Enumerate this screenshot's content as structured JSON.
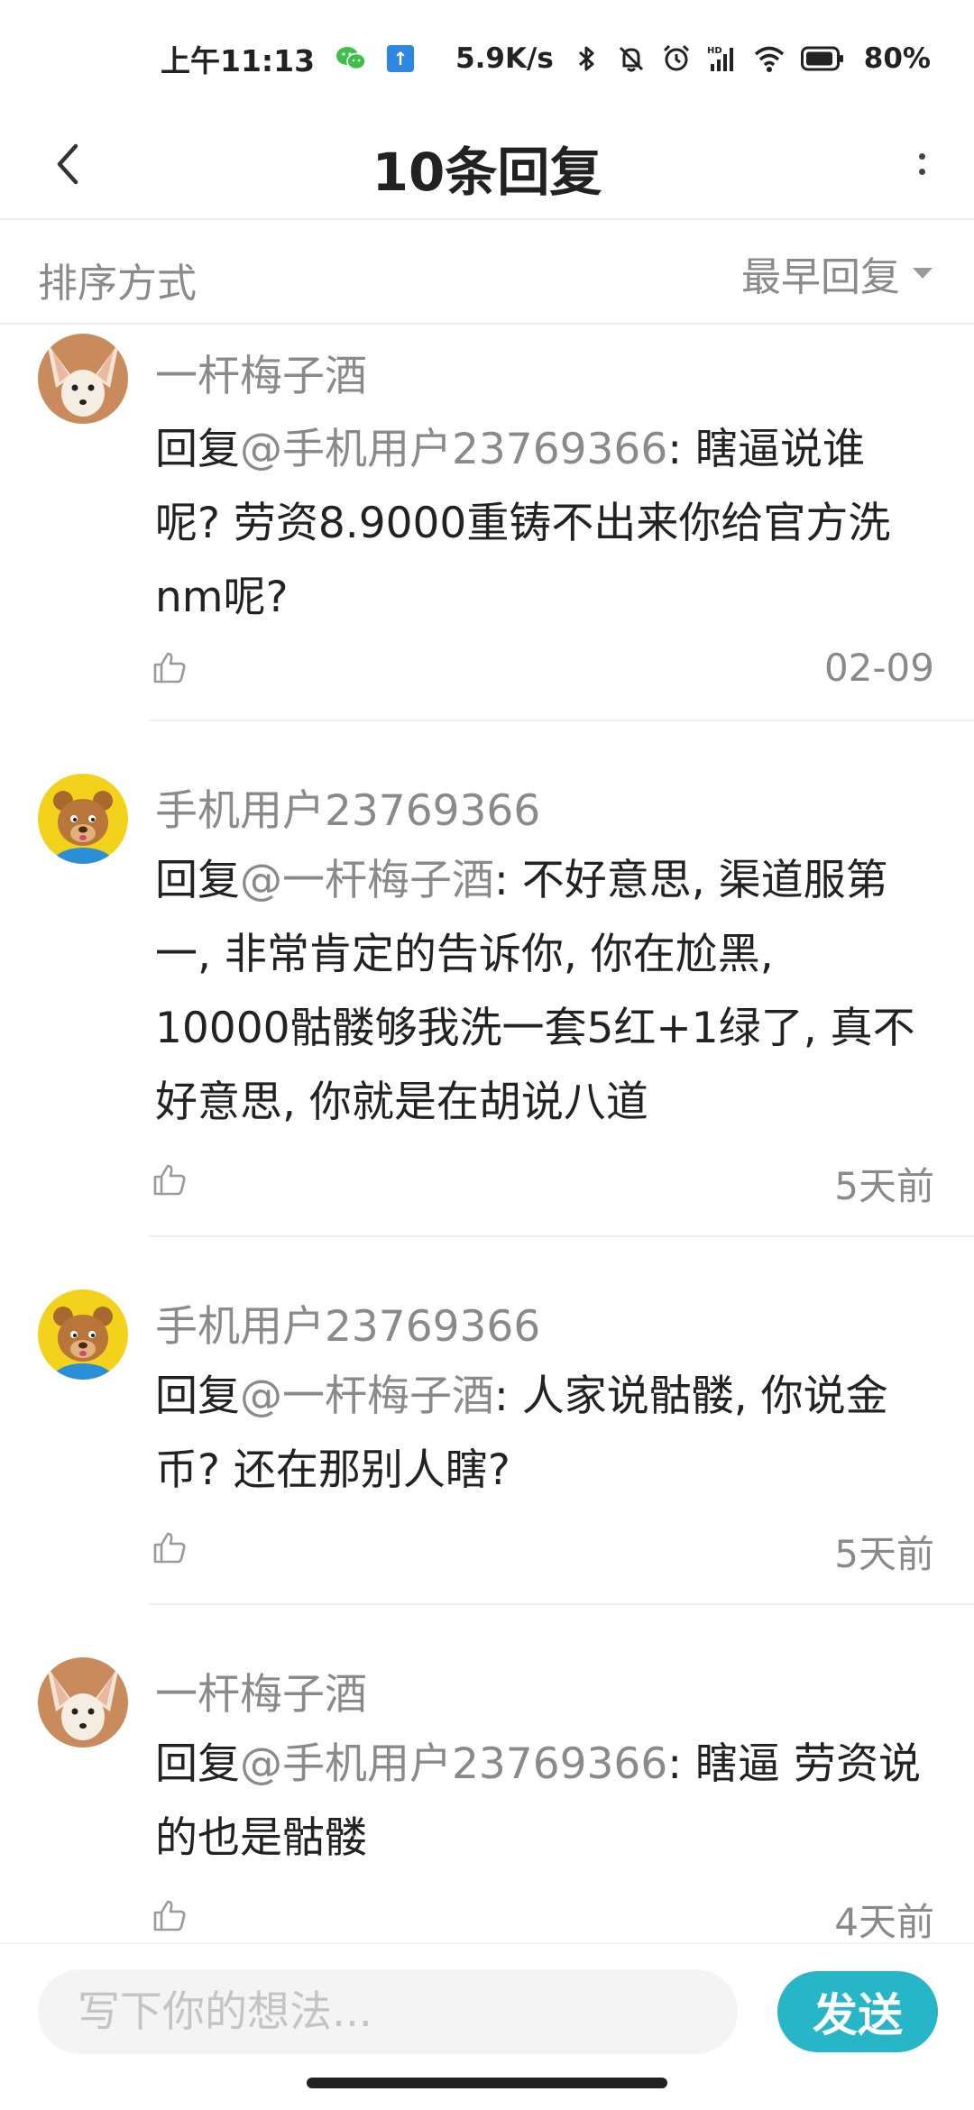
{
  "status_bar": {
    "time": "上午11:13",
    "net_speed": "5.9K/s",
    "battery_percent": "80%",
    "icons": [
      "wechat-icon",
      "upload-icon",
      "bluetooth-icon",
      "mute-bell-icon",
      "alarm-icon",
      "hd-signal-icon",
      "wifi-icon",
      "battery-icon"
    ]
  },
  "nav": {
    "title": "10条回复"
  },
  "sort": {
    "label": "排序方式",
    "value": "最早回复"
  },
  "comments": [
    {
      "author": "一杆梅子酒",
      "avatar": "fox-avatar",
      "reply_prefix": "回复",
      "mention": "@手机用户23769366",
      "text": ": 瞎逼说谁呢? 劳资8.9000重铸不出来你给官方洗nm呢?",
      "time": "02-09"
    },
    {
      "author": "手机用户23769366",
      "avatar": "bear-avatar",
      "reply_prefix": "回复",
      "mention": "@一杆梅子酒",
      "text": ": 不好意思, 渠道服第一, 非常肯定的告诉你, 你在尬黑, 10000骷髅够我洗一套5红+1绿了, 真不好意思, 你就是在胡说八道",
      "time": "5天前"
    },
    {
      "author": "手机用户23769366",
      "avatar": "bear-avatar",
      "reply_prefix": "回复",
      "mention": "@一杆梅子酒",
      "text": ": 人家说骷髅, 你说金币? 还在那别人瞎?",
      "time": "5天前"
    },
    {
      "author": "一杆梅子酒",
      "avatar": "fox-avatar",
      "reply_prefix": "回复",
      "mention": "@手机用户23769366",
      "text": ": 瞎逼 劳资说的也是骷髅",
      "time": "4天前"
    }
  ],
  "input": {
    "placeholder": "写下你的想法...",
    "send_label": "发送"
  },
  "colors": {
    "accent": "#27b6c7",
    "muted_text": "#8a8a8a",
    "body_text": "#222222"
  }
}
